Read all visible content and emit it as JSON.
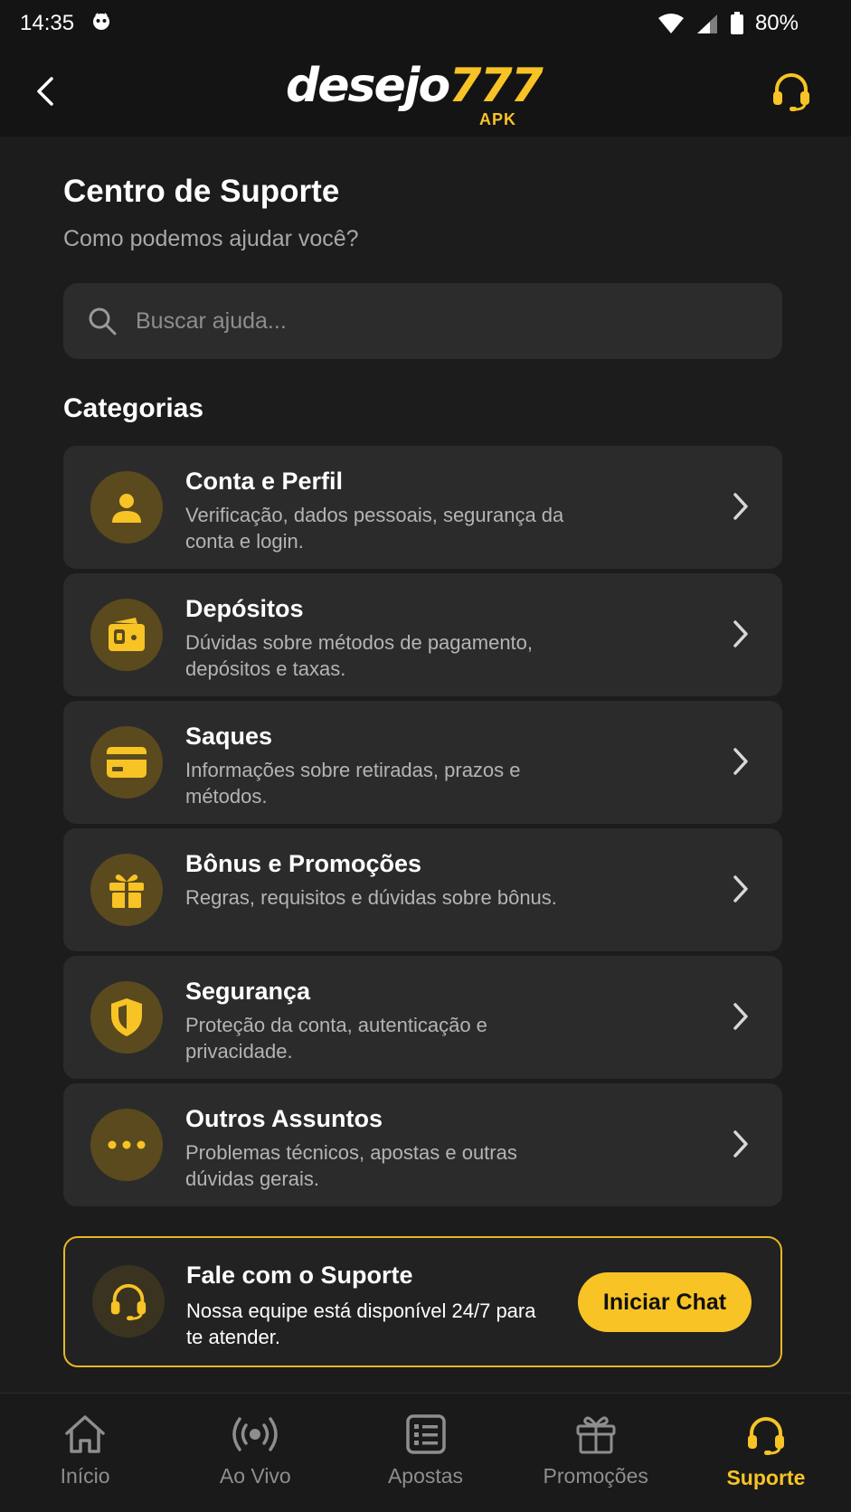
{
  "status_bar": {
    "time": "14:35",
    "battery": "80%"
  },
  "header": {
    "logo_text_main": "desejo",
    "logo_text_num": "777",
    "logo_sub": "APK"
  },
  "page": {
    "title": "Centro de Suporte",
    "subtitle": "Como podemos ajudar você?"
  },
  "search": {
    "placeholder": "Buscar ajuda...",
    "value": ""
  },
  "categories": {
    "title": "Categorias",
    "items": [
      {
        "title": "Conta e Perfil",
        "desc": "Verificação, dados pessoais, segurança da conta e login.",
        "icon": "user-icon"
      },
      {
        "title": "Depósitos",
        "desc": "Dúvidas sobre métodos de pagamento, depósitos e taxas.",
        "icon": "wallet-icon"
      },
      {
        "title": "Saques",
        "desc": "Informações sobre retiradas, prazos e métodos.",
        "icon": "card-icon"
      },
      {
        "title": "Bônus e Promoções",
        "desc": "Regras, requisitos e dúvidas sobre bônus.",
        "icon": "gift-icon"
      },
      {
        "title": "Segurança",
        "desc": "Proteção da conta, autenticação e privacidade.",
        "icon": "shield-icon"
      },
      {
        "title": "Outros Assuntos",
        "desc": "Problemas técnicos, apostas e outras dúvidas gerais.",
        "icon": "more-icon"
      }
    ]
  },
  "support_card": {
    "title": "Fale com o Suporte",
    "desc": "Nossa equipe está disponível 24/7 para te atender.",
    "button": "Iniciar Chat"
  },
  "nav": {
    "items": [
      {
        "label": "Início",
        "icon": "home-icon"
      },
      {
        "label": "Ao Vivo",
        "icon": "live-icon"
      },
      {
        "label": "Apostas",
        "icon": "bets-icon"
      },
      {
        "label": "Promoções",
        "icon": "gift-icon"
      },
      {
        "label": "Suporte",
        "icon": "headset-icon"
      }
    ],
    "active": "Suporte"
  },
  "colors": {
    "accent": "#f7c325",
    "background": "#1c1c1c",
    "card": "#2b2b2b"
  }
}
